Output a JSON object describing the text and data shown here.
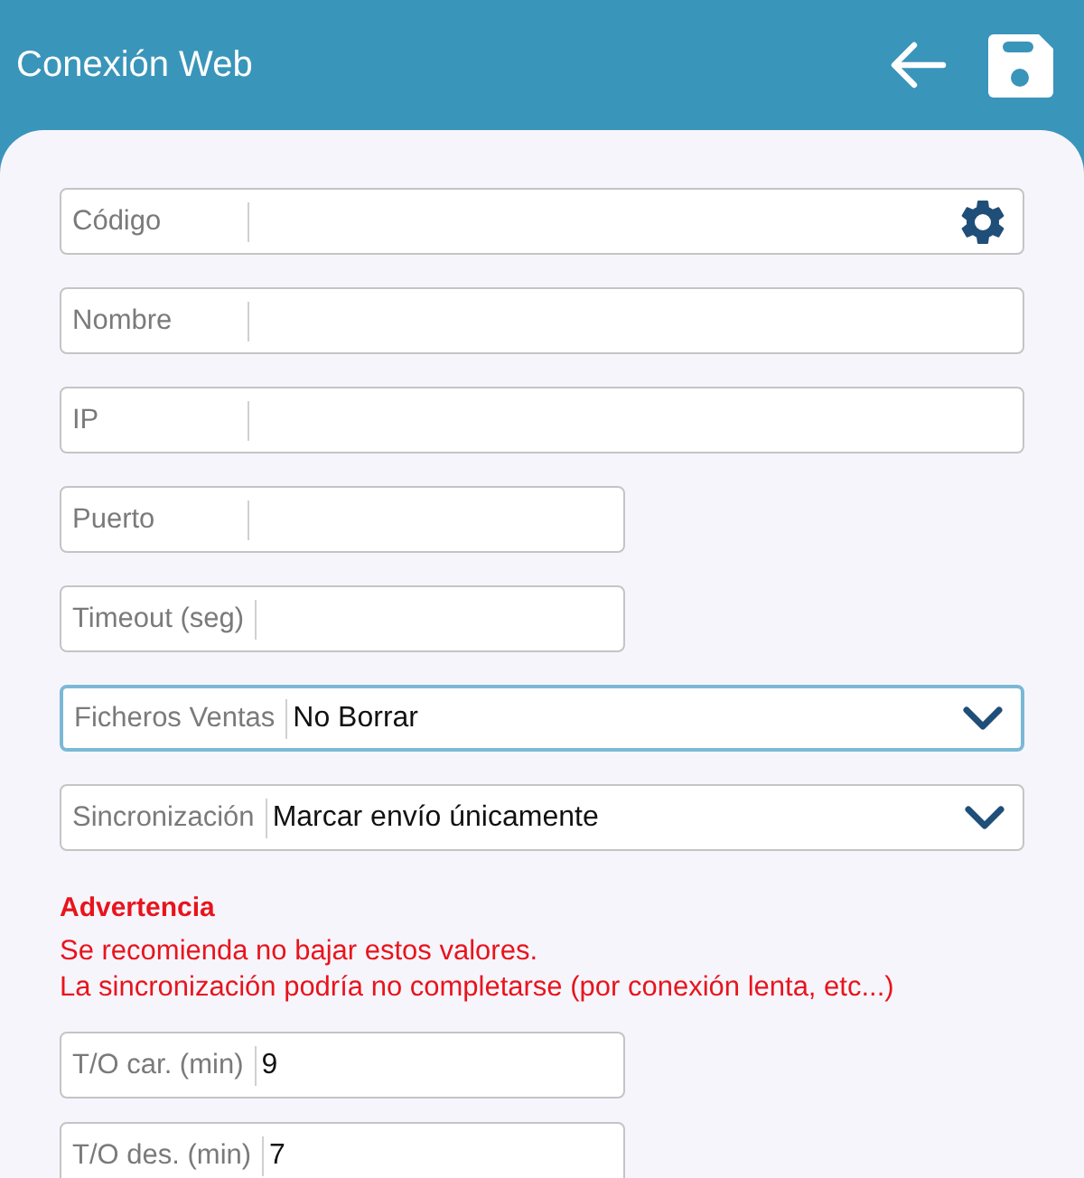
{
  "app_bar": {
    "title": "Conexión Web"
  },
  "fields": [
    {
      "kind": "action",
      "label": "Código",
      "focused": false
    },
    {
      "kind": "text",
      "label": "Nombre",
      "focused": false
    },
    {
      "kind": "text",
      "label": "IP",
      "focused": false
    },
    {
      "kind": "short",
      "label": "Puerto",
      "focused": false
    },
    {
      "kind": "short",
      "label": "Timeout (seg)",
      "focused": false
    },
    {
      "kind": "select",
      "label": "Ficheros Ventas",
      "value": "No Borrar",
      "focused": true
    },
    {
      "kind": "select",
      "label": "Sincronización",
      "value": "Marcar envío únicamente",
      "focused": false
    }
  ],
  "warning": {
    "title": "Advertencia",
    "lines": [
      "Se recomienda no bajar estos valores.",
      "La sincronización podría no completarse (por conexión lenta, etc...)"
    ]
  },
  "timeouts": [
    {
      "kind": "short",
      "label": "T/O car. (min)",
      "value": "9",
      "focused": false
    },
    {
      "kind": "short",
      "label": "T/O des. (min)",
      "value": "7",
      "focused": false
    }
  ]
}
